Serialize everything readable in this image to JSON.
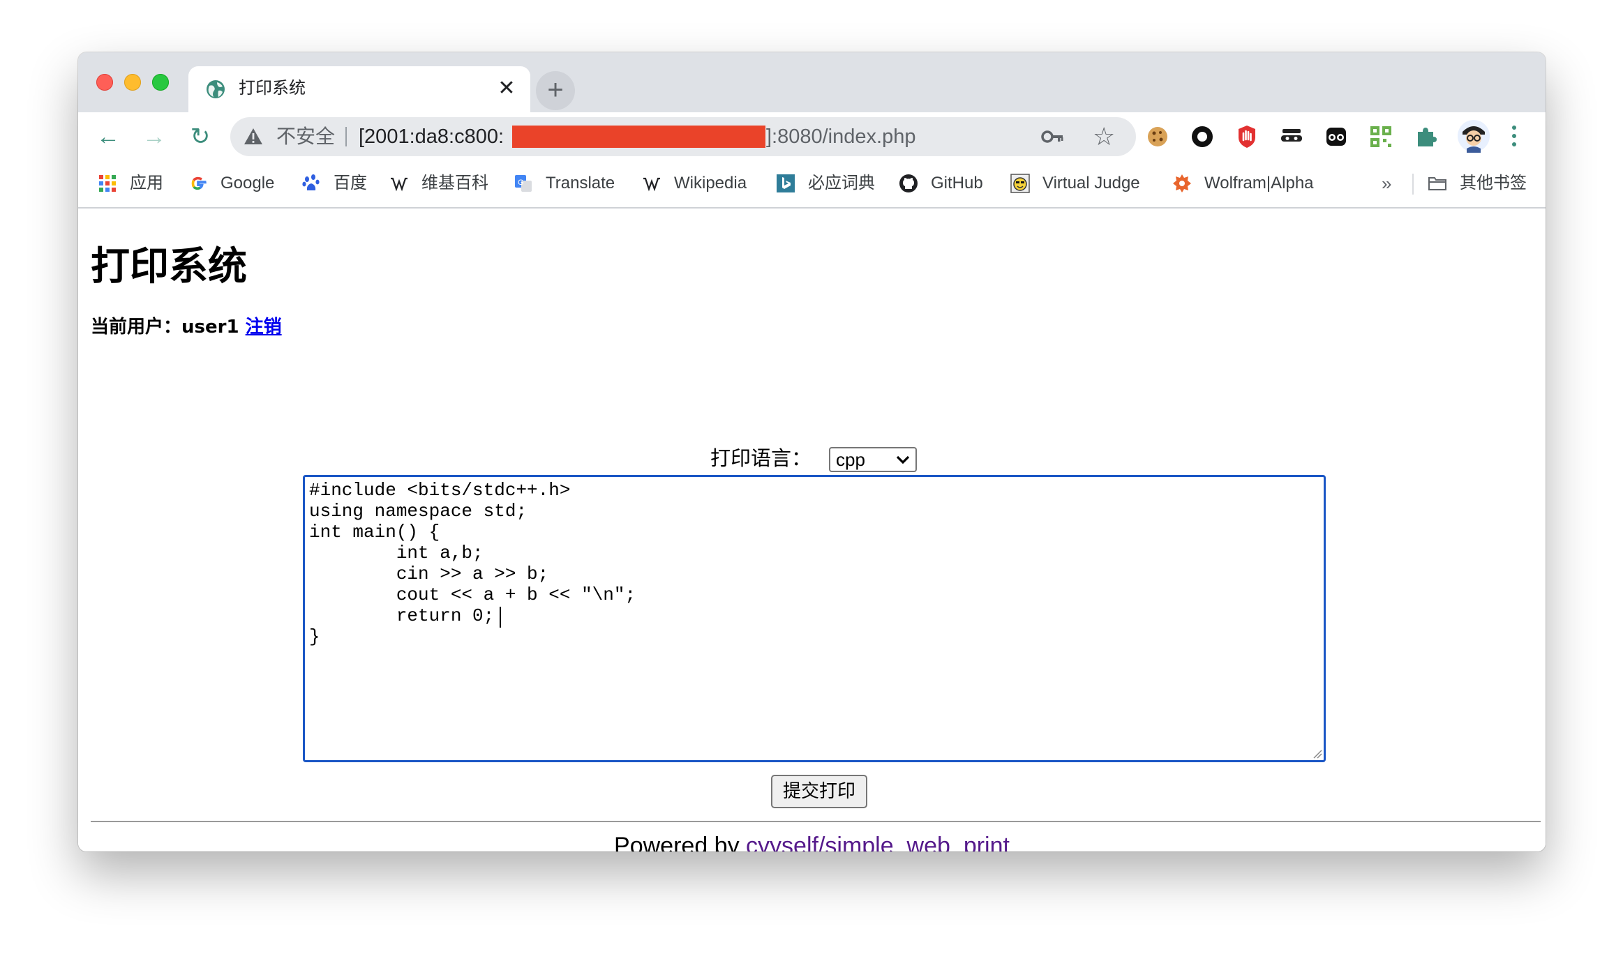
{
  "browser": {
    "tab": {
      "title": "打印系统",
      "close_glyph": "✕"
    },
    "new_tab_glyph": "+",
    "nav": {
      "back_glyph": "←",
      "forward_glyph": "→",
      "reload_glyph": "↻"
    },
    "address_bar": {
      "security_label": "不安全",
      "url_prefix": "[2001:da8:c800:",
      "url_suffix": "]:8080/index.php",
      "redaction_color": "#ea4329"
    },
    "star_glyph": "☆",
    "bookmarks": [
      {
        "label": "应用",
        "icon": "apps-grid-icon"
      },
      {
        "label": "Google",
        "icon": "google-icon"
      },
      {
        "label": "百度",
        "icon": "baidu-paw-icon"
      },
      {
        "label": "维基百科",
        "icon": "wikipedia-icon"
      },
      {
        "label": "Translate",
        "icon": "translate-icon"
      },
      {
        "label": "Wikipedia",
        "icon": "wikipedia-icon"
      },
      {
        "label": "必应词典",
        "icon": "bing-icon"
      },
      {
        "label": "GitHub",
        "icon": "github-icon"
      },
      {
        "label": "Virtual Judge",
        "icon": "vjudge-icon"
      },
      {
        "label": "Wolfram|Alpha",
        "icon": "wolfram-icon"
      }
    ],
    "bookmarks_overflow": "»",
    "other_bookmarks": "其他书签"
  },
  "page": {
    "heading": "打印系统",
    "user": {
      "label": "当前用户：",
      "name": "user1",
      "logout": "注销"
    },
    "language": {
      "label": "打印语言：",
      "selected": "cpp"
    },
    "code_lines": [
      "#include <bits/stdc++.h>",
      "using namespace std;",
      "int main() {",
      "        int a,b;",
      "        cin >> a >> b;",
      "        cout << a + b << \"\\n\";",
      "        return 0;",
      "}"
    ],
    "submit_label": "提交打印",
    "footer": {
      "prefix": "Powered by ",
      "link_text": "cyyself/simple_web_print"
    }
  },
  "colors": {
    "accent_focus": "#1a56c5",
    "link": "#0000ee",
    "visited_link": "#551a8b",
    "nav_icon": "#3c8d7c"
  }
}
